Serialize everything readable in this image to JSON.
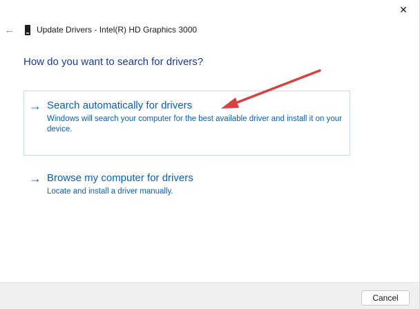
{
  "window": {
    "title": "Update Drivers - Intel(R) HD Graphics 3000",
    "close_glyph": "✕",
    "back_glyph": "←"
  },
  "main": {
    "heading": "How do you want to search for drivers?",
    "options": [
      {
        "title": "Search automatically for drivers",
        "description": "Windows will search your computer for the best available driver and install it on your device.",
        "arrow_glyph": "→"
      },
      {
        "title": "Browse my computer for drivers",
        "description": "Locate and install a driver manually.",
        "arrow_glyph": "→"
      }
    ]
  },
  "footer": {
    "cancel_label": "Cancel"
  },
  "colors": {
    "link_blue": "#0a5fb4",
    "heading_blue": "#1c3b8f",
    "annotation_red": "#d94040"
  }
}
